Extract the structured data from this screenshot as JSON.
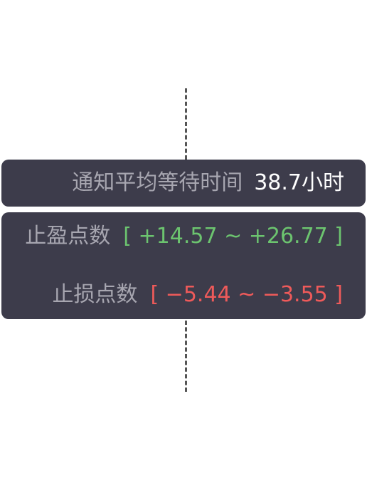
{
  "time_card": {
    "label": "通知平均等待时间",
    "value": "38.7小时"
  },
  "take_profit": {
    "label": "止盈点数",
    "range": "[ +14.57 ~ +26.77 ]"
  },
  "stop_loss": {
    "label": "止损点数",
    "range": "[ −5.44 ~ −3.55 ]"
  },
  "colors": {
    "card_bg": "#3d3c4b",
    "label": "#a7a6b0",
    "value": "#ffffff",
    "profit": "#6cc46f",
    "loss": "#ee5a5a"
  }
}
